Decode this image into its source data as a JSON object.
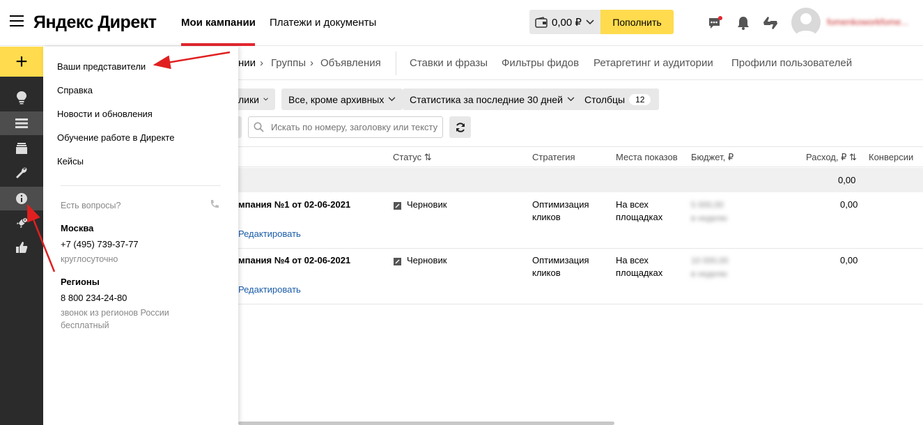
{
  "header": {
    "logo": "Яндекс Директ",
    "nav": [
      "Мои кампании",
      "Платежи и документы"
    ],
    "balance": "0,00 ₽",
    "topup_label": "Пополнить",
    "user": "fomenkoworkfome..."
  },
  "menu": {
    "items": [
      "Ваши представители",
      "Справка",
      "Новости и обновления",
      "Обучение работе в Директе",
      "Кейсы"
    ],
    "questions": "Есть вопросы?",
    "moscow_title": "Москва",
    "moscow_phone": "+7 (495) 739-37-77",
    "moscow_hours": "круглосуточно",
    "regions_title": "Регионы",
    "regions_phone": "8 800 234-24-80",
    "regions_note_1": "звонок из регионов России",
    "regions_note_2": "бесплатный"
  },
  "tabs": {
    "crumb_1": "нии",
    "crumb_2": "Группы",
    "crumb_3": "Объявления",
    "items": [
      "Ставки и фразы",
      "Фильтры фидов",
      "Ретаргетинг и аудитории",
      "Профили пользователей"
    ]
  },
  "filters": {
    "f1": "лики",
    "f2": "Все, кроме архивных",
    "f3": "Статистика за последние 30 дней",
    "columns_label": "Столбцы",
    "columns_count": "12"
  },
  "search": {
    "placeholder": "Искать по номеру, заголовку или тексту"
  },
  "table": {
    "headers": {
      "status": "Статус",
      "strategy": "Стратегия",
      "places": "Места показов",
      "budget": "Бюджет, ₽",
      "spend": "Расход, ₽",
      "conv": "Конверсии"
    },
    "total_spend": "0,00",
    "rows": [
      {
        "name": "мпания №1 от 02-06-2021",
        "edit": "Редактировать",
        "status": "Черновик",
        "strategy_1": "Оптимизация",
        "strategy_2": "кликов",
        "places_1": "На всех",
        "places_2": "площадках",
        "budget_1": "5 000,00",
        "budget_2": "в неделю",
        "spend": "0,00"
      },
      {
        "name": "мпания №4 от 02-06-2021",
        "edit": "Редактировать",
        "status": "Черновик",
        "strategy_1": "Оптимизация",
        "strategy_2": "кликов",
        "places_1": "На всех",
        "places_2": "площадках",
        "budget_1": "10 000,00",
        "budget_2": "в неделю",
        "spend": "0,00"
      }
    ]
  },
  "colors": {
    "accent_yellow": "#ffdb4d",
    "nav_red": "#e3262f",
    "sidebar_dark": "#2b2b2b",
    "link_blue": "#1a5ca8",
    "annotation_red": "#e02020"
  }
}
